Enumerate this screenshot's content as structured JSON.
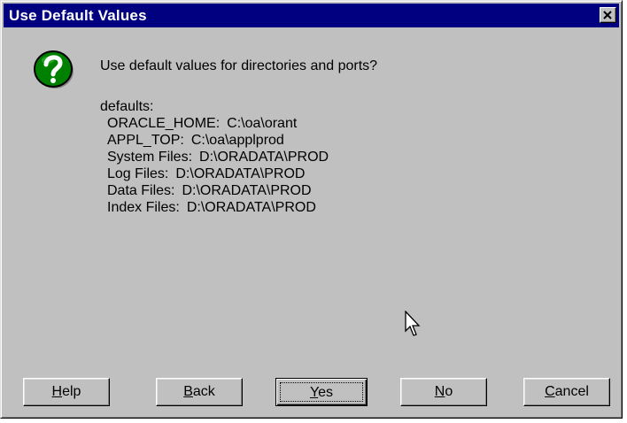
{
  "window": {
    "title": "Use Default Values",
    "close_glyph": "close-icon"
  },
  "dialog": {
    "icon": "question-icon",
    "prompt": "Use default values for directories and ports?",
    "defaults_label": "defaults:",
    "defaults": [
      {
        "key": "ORACLE_HOME:",
        "value": "C:\\oa\\orant"
      },
      {
        "key": "APPL_TOP:",
        "value": "C:\\oa\\applprod"
      },
      {
        "key": "System Files:",
        "value": "D:\\ORADATA\\PROD"
      },
      {
        "key": "Log Files:",
        "value": "D:\\ORADATA\\PROD"
      },
      {
        "key": "Data Files:",
        "value": "D:\\ORADATA\\PROD"
      },
      {
        "key": "Index Files:",
        "value": "D:\\ORADATA\\PROD"
      }
    ]
  },
  "buttons": {
    "help": {
      "mnemonic": "H",
      "rest": "elp"
    },
    "back": {
      "mnemonic": "B",
      "rest": "ack"
    },
    "yes": {
      "mnemonic": "Y",
      "rest": "es"
    },
    "no": {
      "mnemonic": "N",
      "rest": "o"
    },
    "cancel": {
      "mnemonic": "C",
      "rest": "ancel"
    }
  },
  "colors": {
    "titlebar": "#000080",
    "face": "#c0c0c0",
    "icon_green": "#008000"
  }
}
